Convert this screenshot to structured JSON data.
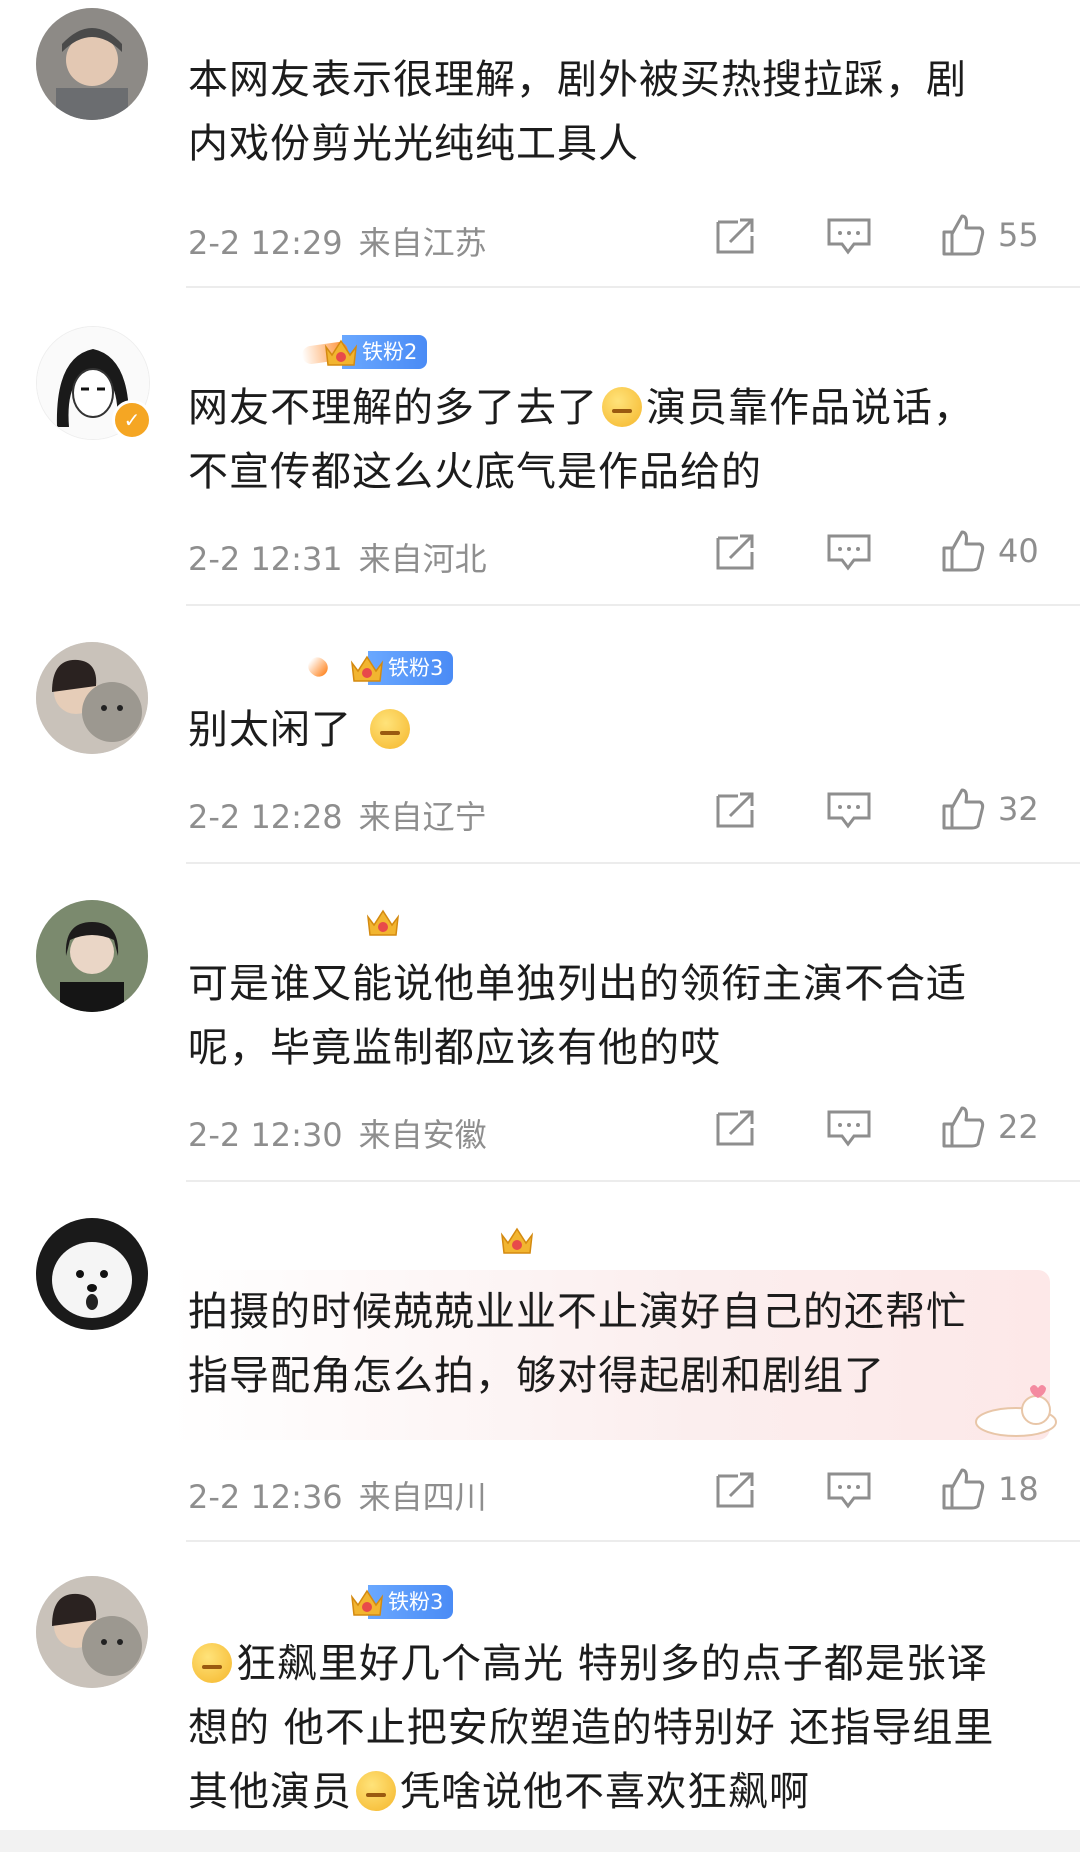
{
  "comments": [
    {
      "badge": "",
      "text_lines": [
        "本网友表示很理解，剧外被买热搜拉踩，剧",
        "内戏份剪光光纯纯工具人"
      ],
      "date": "2-2 12:29",
      "location": "来自江苏",
      "likes": "55"
    },
    {
      "badge": "铁粉2",
      "text_lines": [
        "网友不理解的多了去了",
        "演员靠作品说话，",
        "不宣传都这么火底气是作品给的"
      ],
      "date": "2-2 12:31",
      "location": "来自河北",
      "likes": "40"
    },
    {
      "badge": "铁粉3",
      "text_lines": [
        "别太闲了"
      ],
      "date": "2-2 12:28",
      "location": "来自辽宁",
      "likes": "32"
    },
    {
      "badge": "",
      "text_lines": [
        "可是谁又能说他单独列出的领衔主演不合适",
        "呢，毕竟监制都应该有他的哎"
      ],
      "date": "2-2 12:30",
      "location": "来自安徽",
      "likes": "22"
    },
    {
      "badge": "",
      "text_lines": [
        "拍摄的时候兢兢业业不止演好自己的还帮忙",
        "指导配角怎么拍，够对得起剧和剧组了"
      ],
      "date": "2-2 12:36",
      "location": "来自四川",
      "likes": "18"
    },
    {
      "badge": "铁粉3",
      "text_lines": [
        "狂飙里好几个高光 特别多的点子都是张译",
        "想的 他不止把安欣塑造的特别好 还指导组里",
        "其他演员",
        "凭啥说他不喜欢狂飙啊"
      ],
      "date": "",
      "location": "",
      "likes": ""
    }
  ],
  "icons": {
    "share": "share-icon",
    "comment": "comment-icon",
    "like": "thumbs-up-icon"
  },
  "colors": {
    "badge_blue": "#4a8bf5",
    "meta_gray": "#8e8e8e",
    "verified": "#f5a623"
  }
}
